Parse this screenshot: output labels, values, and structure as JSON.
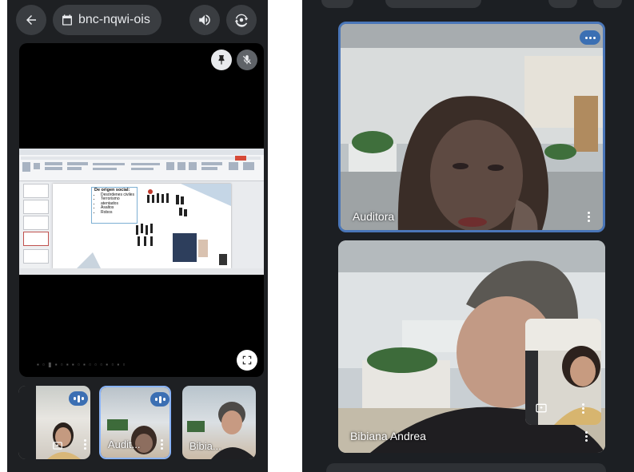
{
  "left_call": {
    "meeting_code": "bnc-nqwi-ois",
    "icons": {
      "back": "arrow-left-icon",
      "calendar": "calendar-icon",
      "audio": "speaker-icon",
      "camera": "switch-camera-icon",
      "pin": "pin-icon",
      "muted": "mic-off-icon",
      "fullscreen": "fullscreen-icon"
    },
    "presentation": {
      "slide_heading": "De origen social:",
      "slide_bullets": [
        "Desórdenes civiles",
        "Terrorismo",
        "atentados",
        "Asaltos",
        "Robos"
      ]
    },
    "participants": [
      {
        "label": ""
      },
      {
        "label": "Audit..."
      },
      {
        "label": "Bibia..."
      }
    ]
  },
  "right_call": {
    "participants": [
      {
        "name": "Auditora"
      },
      {
        "name": "Bibiana Andrea"
      }
    ]
  },
  "colors": {
    "accent_blue": "#3b6fb3",
    "bar_bg": "#3a3d41",
    "app_bg": "#1e2023"
  }
}
